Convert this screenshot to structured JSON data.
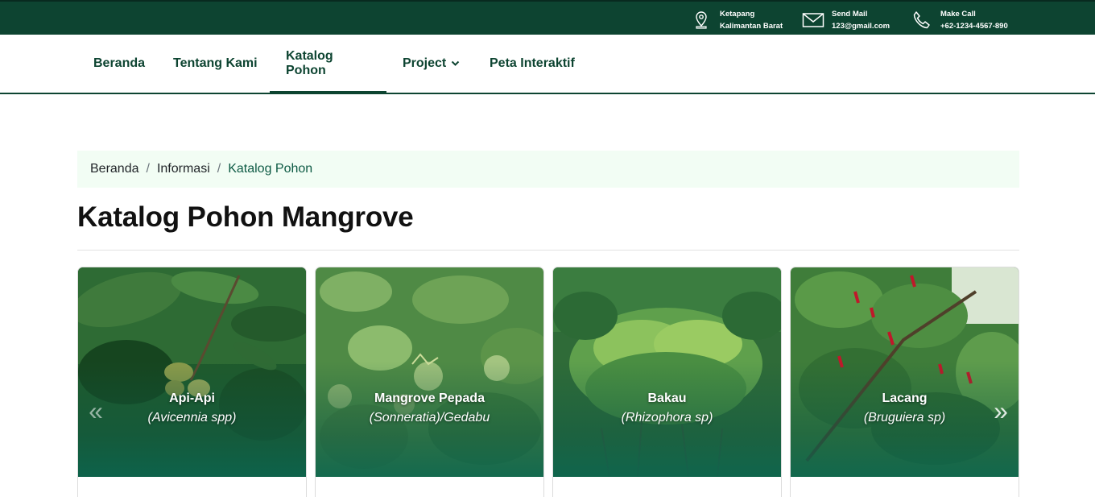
{
  "topbar": {
    "location": {
      "icon": "map-pin-icon",
      "line1": "Ketapang",
      "line2": "Kalimantan Barat"
    },
    "mail": {
      "icon": "envelope-icon",
      "line1": "Send Mail",
      "line2": "123@gmail.com"
    },
    "call": {
      "icon": "phone-icon",
      "line1": "Make Call",
      "line2": "+62-1234-4567-890"
    }
  },
  "nav": {
    "items": [
      {
        "label": "Beranda"
      },
      {
        "label": "Tentang Kami"
      },
      {
        "label": "Katalog Pohon",
        "active": true
      },
      {
        "label": "Project",
        "dropdown": true
      },
      {
        "label": "Peta Interaktif"
      }
    ]
  },
  "breadcrumb": {
    "items": [
      "Beranda",
      "Informasi",
      "Katalog Pohon"
    ],
    "separator": "/"
  },
  "page": {
    "title": "Katalog Pohon Mangrove"
  },
  "catalog": {
    "cards": [
      {
        "name": "Api-Api",
        "latin": "(Avicennia spp)"
      },
      {
        "name": "Mangrove Pepada",
        "latin": "(Sonneratia)/Gedabu"
      },
      {
        "name": "Bakau",
        "latin": "(Rhizophora sp)"
      },
      {
        "name": "Lacang",
        "latin": "(Bruguiera sp)"
      }
    ],
    "prev_icon": "«",
    "next_icon": "»"
  },
  "colors": {
    "primary": "#0d4431",
    "breadcrumb_bg": "#f2fdf4",
    "breadcrumb_active": "#0d5a44"
  }
}
